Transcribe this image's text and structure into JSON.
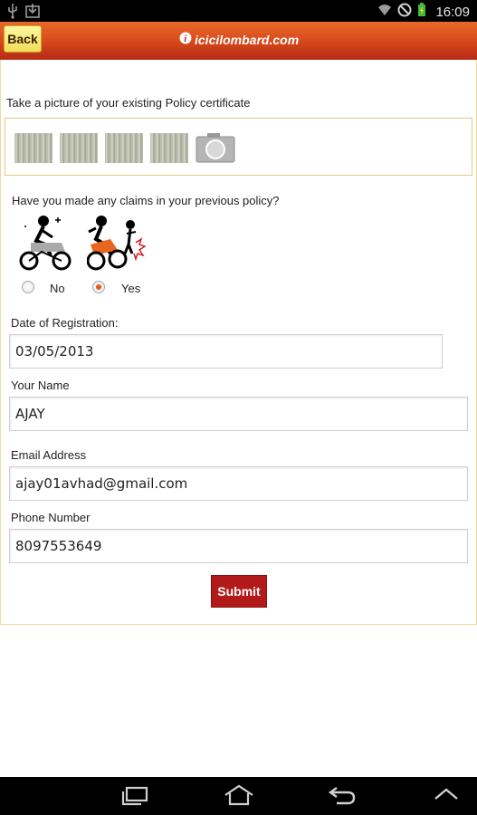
{
  "status_bar": {
    "time": "16:09",
    "icons": [
      "usb-icon",
      "download-icon",
      "wifi-icon",
      "no-signal-icon",
      "battery-icon"
    ]
  },
  "header": {
    "back_label": "Back",
    "brand": "icicilombard.com",
    "brand_colors": {
      "bar_top": "#e86a2a",
      "bar_bottom": "#b62a14",
      "back_button": "#f2dc5a"
    }
  },
  "policy_photo": {
    "prompt": "Take a picture of your existing Policy certificate",
    "thumbnail_count": 4,
    "camera_icon": "camera-icon"
  },
  "claims": {
    "question": "Have you made any claims in your previous policy?",
    "options": [
      {
        "label": "No",
        "icon": "safe-bike-icon",
        "checked": false
      },
      {
        "label": "Yes",
        "icon": "crash-bike-icon",
        "checked": true
      }
    ]
  },
  "form": {
    "registration_label": "Date of Registration:",
    "registration_value": "03/05/2013",
    "name_label": "Your Name",
    "name_value": "AJAY",
    "email_label": "Email Address",
    "email_value": "ajay01avhad@gmail.com",
    "phone_label": "Phone Number",
    "phone_value": "8097553649",
    "submit_label": "Submit",
    "submit_color": "#b11a18"
  },
  "nav_bar": {
    "buttons": [
      "recent-apps-icon",
      "home-icon",
      "back-arrow-icon",
      "menu-up-icon"
    ]
  }
}
